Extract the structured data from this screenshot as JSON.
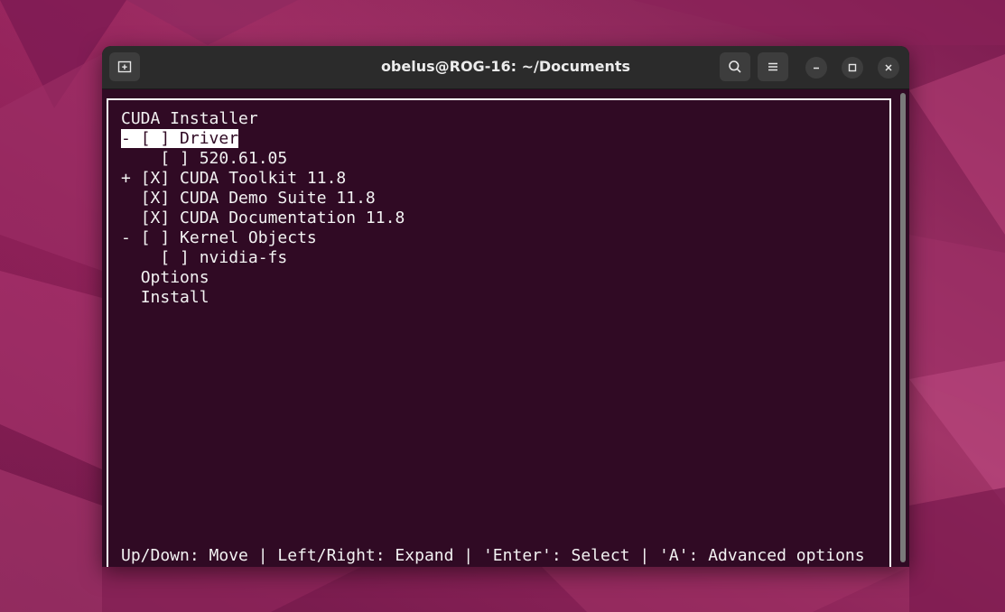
{
  "window": {
    "title": "obelus@ROG-16: ~/Documents",
    "icons": {
      "new_tab": "new-tab-icon",
      "search": "search-icon",
      "menu": "hamburger-menu-icon",
      "minimize": "minimize-icon",
      "maximize": "maximize-icon",
      "close": "close-icon"
    }
  },
  "terminal": {
    "heading": "CUDA Installer",
    "items": [
      {
        "prefix": "- ",
        "label": "[ ] Driver",
        "selected": true
      },
      {
        "prefix": "",
        "label": "    [ ] 520.61.05",
        "selected": false
      },
      {
        "prefix": "+ ",
        "label": "[X] CUDA Toolkit 11.8",
        "selected": false
      },
      {
        "prefix": "  ",
        "label": "[X] CUDA Demo Suite 11.8",
        "selected": false
      },
      {
        "prefix": "  ",
        "label": "[X] CUDA Documentation 11.8",
        "selected": false
      },
      {
        "prefix": "- ",
        "label": "[ ] Kernel Objects",
        "selected": false
      },
      {
        "prefix": "",
        "label": "    [ ] nvidia-fs",
        "selected": false
      },
      {
        "prefix": "  ",
        "label": "Options",
        "selected": false
      },
      {
        "prefix": "  ",
        "label": "Install",
        "selected": false
      }
    ],
    "help": "Up/Down: Move | Left/Right: Expand | 'Enter': Select | 'A': Advanced options"
  },
  "colors": {
    "terminal_bg": "#300a24",
    "terminal_fg": "#f2f2f2",
    "titlebar_bg": "#2b2b2b"
  }
}
